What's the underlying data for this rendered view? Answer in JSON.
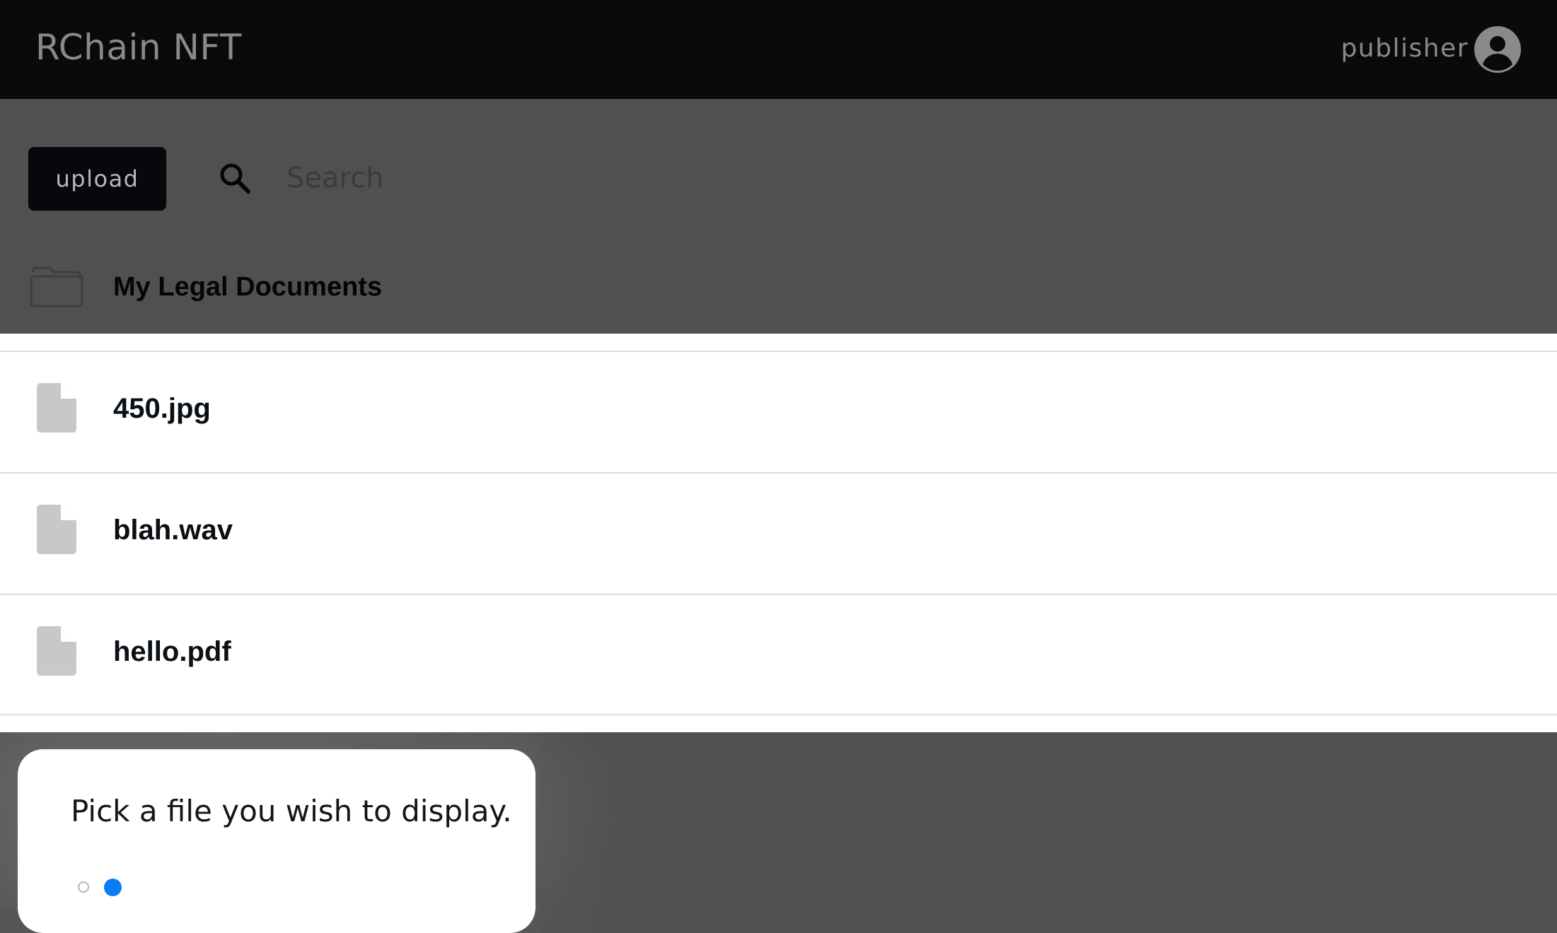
{
  "app": {
    "title": "RChain NFT"
  },
  "user": {
    "name": "publisher",
    "avatar_icon": "user-circle-icon"
  },
  "toolbar": {
    "upload_label": "upload",
    "search_icon": "search-icon",
    "search_placeholder": "Search",
    "search_value": ""
  },
  "folder": {
    "icon": "folder-open-icon",
    "name": "My Legal Documents"
  },
  "files": [
    {
      "name": "450.jpg",
      "icon": "file-icon"
    },
    {
      "name": "blah.wav",
      "icon": "file-icon"
    },
    {
      "name": "hello.pdf",
      "icon": "file-icon"
    }
  ],
  "popup": {
    "message": "Pick a file you wish to display.",
    "pagination": {
      "total": 2,
      "active": 2
    }
  },
  "colors": {
    "topbar": "#0a0a0a",
    "page_background": "#505050",
    "accent": "#0a7cf5",
    "file_icon": "#c8c8c8"
  }
}
